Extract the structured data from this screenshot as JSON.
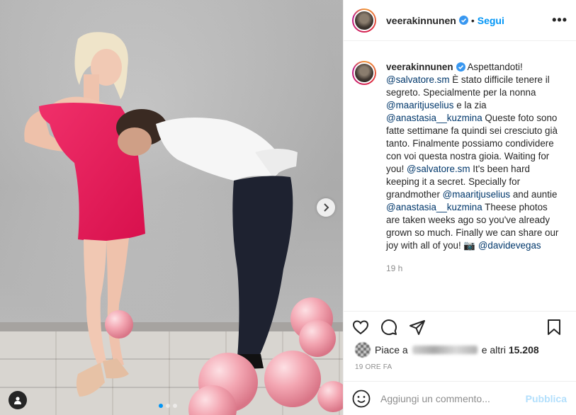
{
  "photo": {
    "carousel": {
      "count": 3,
      "active_index": 0
    }
  },
  "header": {
    "username": "veerakinnunen",
    "bullet": "•",
    "follow_label": "Segui",
    "more_label": "•••"
  },
  "caption": {
    "username": "veerakinnunen",
    "segments": [
      {
        "type": "text",
        "text": "Aspettandoti! "
      },
      {
        "type": "mention",
        "text": "@salvatore.sm"
      },
      {
        "type": "text",
        "text": " È stato difficile tenere il segreto. Specialmente per la nonna "
      },
      {
        "type": "mention",
        "text": "@maaritjuselius"
      },
      {
        "type": "text",
        "text": " e la zia "
      },
      {
        "type": "mention",
        "text": "@anastasia__kuzmina"
      },
      {
        "type": "text",
        "text": " Queste foto sono fatte settimane fa quindi sei cresciuto già tanto. Finalmente possiamo condividere con voi questa nostra gioia. Waiting for you! "
      },
      {
        "type": "mention",
        "text": "@salvatore.sm"
      },
      {
        "type": "text",
        "text": " It's been hard keeping it a secret. Specially for grandmother "
      },
      {
        "type": "mention",
        "text": "@maaritjuselius"
      },
      {
        "type": "text",
        "text": " and auntie "
      },
      {
        "type": "mention",
        "text": "@anastasia__kuzmina"
      },
      {
        "type": "text",
        "text": " Theese photos are taken weeks ago so you've already grown so much. Finally we can share our joy with all of you! 📷 "
      },
      {
        "type": "mention",
        "text": "@davidevegas"
      }
    ],
    "time": "19 h"
  },
  "actions": {
    "icons": [
      "heart-icon",
      "comment-icon",
      "share-icon",
      "bookmark-icon"
    ]
  },
  "likes": {
    "prefix": "Piace a",
    "suffix": "e altri",
    "count": "15.208"
  },
  "timestamp": "19 ORE FA",
  "comment_box": {
    "placeholder": "Aggiungi un commento...",
    "publish_label": "Pubblica"
  },
  "colors": {
    "accent": "#0095f6",
    "mention": "#00376b",
    "dress": "#e8195a",
    "balloon": "#f2a0ad"
  }
}
